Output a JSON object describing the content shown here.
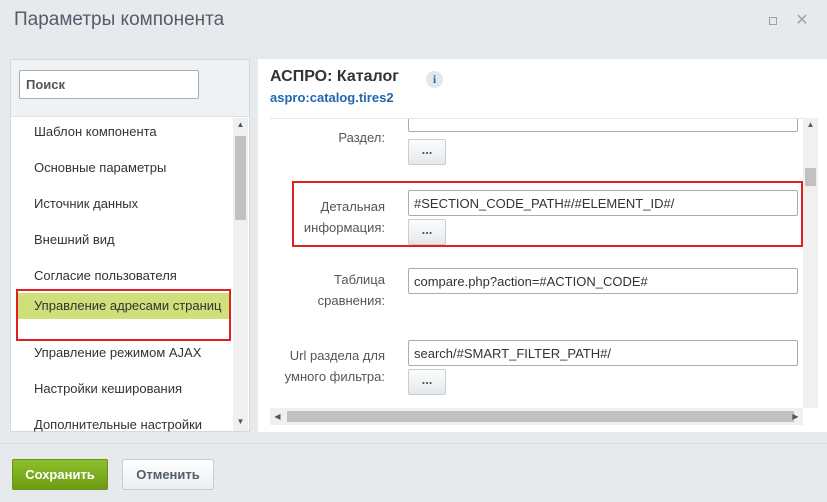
{
  "window": {
    "title": "Параметры компонента",
    "maximize_icon": "maximize-icon",
    "close_icon": "close-icon",
    "close_glyph": "✕"
  },
  "sidebar": {
    "search_placeholder": "Поиск",
    "items": [
      {
        "label": "Шаблон компонента"
      },
      {
        "label": "Основные параметры"
      },
      {
        "label": "Источник данных"
      },
      {
        "label": "Внешний вид"
      },
      {
        "label": "Согласие пользователя"
      },
      {
        "label": "Управление адресами страниц",
        "active": true
      },
      {
        "label": "Управление режимом AJAX"
      },
      {
        "label": "Настройки кеширования"
      },
      {
        "label": "Дополнительные настройки"
      }
    ]
  },
  "component": {
    "title": "АСПРО: Каталог",
    "info_icon_glyph": "i",
    "code": "aspro:catalog.tires2"
  },
  "params": [
    {
      "label": "Раздел:",
      "value": "",
      "has_button": true
    },
    {
      "label": "Детальная информация:",
      "value": "#SECTION_CODE_PATH#/#ELEMENT_ID#/",
      "has_button": true,
      "highlighted": true
    },
    {
      "label": "Таблица сравнения:",
      "value": "compare.php?action=#ACTION_CODE#",
      "has_button": false
    },
    {
      "label": "Url раздела для умного фильтра:",
      "value": "search/#SMART_FILTER_PATH#/",
      "has_button": true
    }
  ],
  "dots_label": "...",
  "footer": {
    "save_label": "Сохранить",
    "cancel_label": "Отменить"
  },
  "colors": {
    "accent_green": "#7aab1f",
    "active_item_bg": "#cde07a",
    "highlight_red": "#e02020",
    "link_blue": "#2067b0"
  }
}
